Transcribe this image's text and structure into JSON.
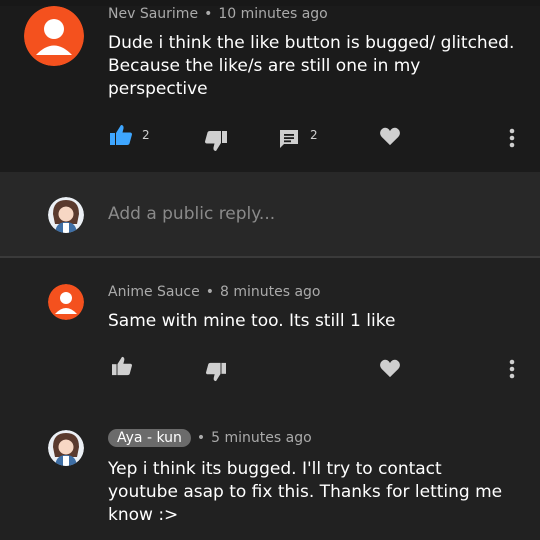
{
  "comments": [
    {
      "author": "Nev Saurime",
      "time": "10 minutes ago",
      "text": "Dude i think the like button is bugged/ glitched. Because the like/s are still one in my perspective",
      "likes": "2",
      "replies": "2"
    },
    {
      "author": "Anime Sauce",
      "time": "8 minutes ago",
      "text": "Same with mine too. Its still 1 like"
    },
    {
      "author": "Aya - kun",
      "time": "5 minutes ago",
      "text": "Yep i think its bugged. I'll try to contact youtube asap to fix this. Thanks for letting me know :>"
    }
  ],
  "reply_box": {
    "placeholder": "Add a public reply..."
  },
  "separator": "•",
  "colors": {
    "like_active": "#3ea6ff",
    "icon_gray": "#cfcfcf",
    "avatar_orange": "#f4511e",
    "badge_gray": "#6b6b6b"
  },
  "icons": {
    "like": "thumbs-up-icon",
    "dislike": "thumbs-down-icon",
    "reply": "comment-icon",
    "heart": "heart-icon",
    "menu": "more-vert-icon"
  }
}
